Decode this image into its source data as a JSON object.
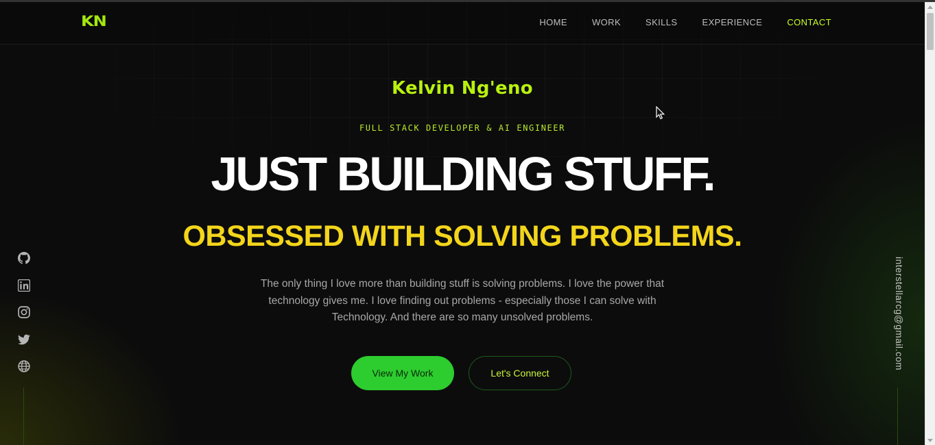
{
  "brand": {
    "logo": "KN"
  },
  "nav": {
    "items": [
      "HOME",
      "WORK",
      "SKILLS",
      "EXPERIENCE",
      "CONTACT"
    ],
    "active": "CONTACT"
  },
  "hero": {
    "name": "Kelvin Ng'eno",
    "role": "FULL STACK DEVELOPER & AI ENGINEER",
    "headline": "JUST BUILDING STUFF.",
    "subheadline": "OBSESSED WITH SOLVING PROBLEMS.",
    "intro": "The only thing I love more than building stuff is solving problems. I love the power that technology gives me. I love finding out problems - especially those I can solve with Technology. And there are so many unsolved problems.",
    "primary_button": "View My Work",
    "secondary_button": "Let's Connect"
  },
  "socials": [
    "github-icon",
    "linkedin-icon",
    "instagram-icon",
    "twitter-icon",
    "globe-icon"
  ],
  "email": "interstellarcg@gmail.com",
  "colors": {
    "accent": "#b8f10f",
    "yellow": "#f3d51b",
    "button_green": "#2dcc2f",
    "background": "#0c0c0c"
  }
}
